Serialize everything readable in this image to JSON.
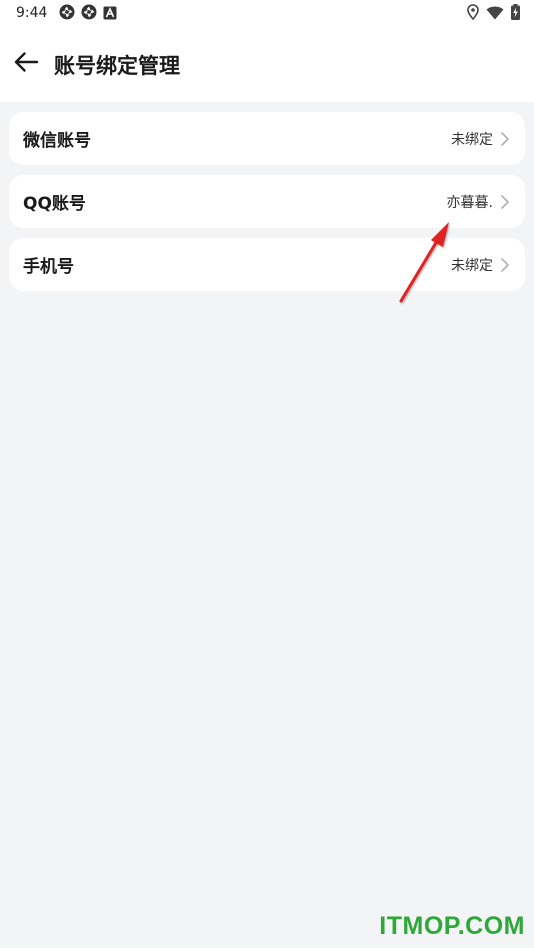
{
  "status_bar": {
    "time": "9:44",
    "left_icons": [
      "aperture-icon",
      "aperture-icon",
      "font-a-icon"
    ],
    "right_icons": [
      "location-pin-icon",
      "wifi-icon",
      "battery-charging-icon"
    ]
  },
  "header": {
    "back_icon": "arrow-left-icon",
    "title": "账号绑定管理"
  },
  "accounts": [
    {
      "label": "微信账号",
      "value": "未绑定",
      "icon": "chevron-right-icon"
    },
    {
      "label": "QQ账号",
      "value": "亦暮暮.",
      "icon": "chevron-right-icon"
    },
    {
      "label": "手机号",
      "value": "未绑定",
      "icon": "chevron-right-icon"
    }
  ],
  "annotation": {
    "arrow_color": "#e02020"
  },
  "watermark": "ITMOP.COM",
  "colors": {
    "background": "#f3f4f6",
    "card": "#ffffff",
    "watermark": "#2fa83a"
  }
}
